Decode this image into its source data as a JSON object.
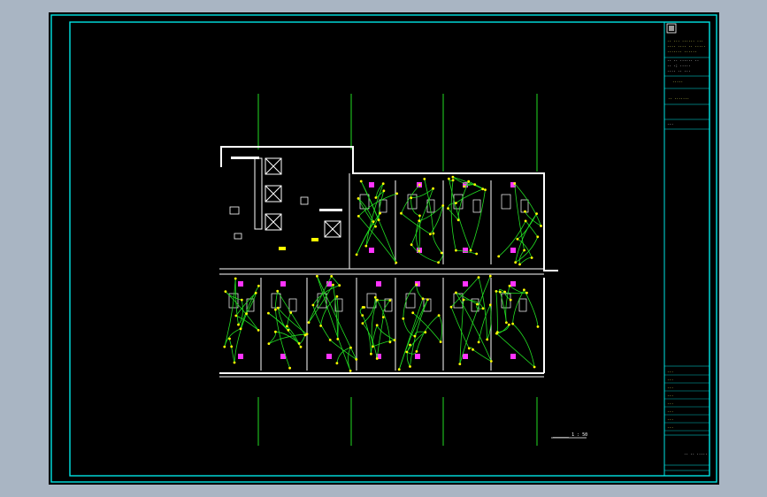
{
  "colors": {
    "background": "#a9b5c3",
    "canvas": "#000000",
    "frame": "#00e5e5",
    "axis": "#22dd22",
    "wall": "#ffffff",
    "wiring": "#22dd22",
    "device": "#ffff00",
    "fixture": "#ff33ff",
    "titleblock_text": "#ffff66"
  },
  "drawing": {
    "caption": "______ 1 : 50",
    "scale": "1 : 50"
  },
  "title_block": {
    "logo": "logo-icon",
    "company_lines": [
      "·· ··· ······ ···",
      "···· ···· ·· ·····",
      "······· ······"
    ],
    "contact_lines": [
      "·· ·· ······ ··",
      "·· ·: ·····",
      "···· ·· ···"
    ],
    "project_name": "·····",
    "drawing_name": "·· ·······",
    "sheet_no": "···",
    "rows": [
      "···",
      "···",
      "···",
      "···",
      "···",
      "···",
      "···",
      "···"
    ],
    "date": "·· ·· ·····"
  }
}
